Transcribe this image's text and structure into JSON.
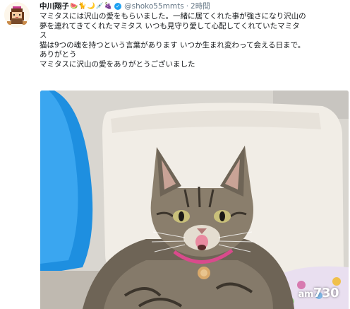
{
  "tweet": {
    "display_name": "中川翔子",
    "name_emojis": [
      "🍉",
      "🐈",
      "🌙",
      "💉",
      "🍇"
    ],
    "verified": true,
    "handle": "@shoko55mmts",
    "separator": "·",
    "time": "2時間",
    "text_lines": [
      "マミタスには沢山の愛をもらいました。一緒に居てくれた事が強さになり沢山の",
      "夢を連れてきてくれたマミタス いつも見守り愛して心配してくれていたマミタ",
      "ス",
      "猫は9つの魂を持つという言葉があります いつか生まれ変わって会える日まで。",
      "ありがとう",
      "マミタスに沢山の愛をありがとうございました"
    ]
  },
  "photo": {
    "subject_icon": "cat-photo",
    "watermark_prefix": "am",
    "watermark_number": "730"
  },
  "colors": {
    "name": "#14171a",
    "muted": "#657786",
    "verified": "#1da1f2",
    "pillow": "#f1ede6",
    "blue_cushion": "#1e8fe0"
  }
}
